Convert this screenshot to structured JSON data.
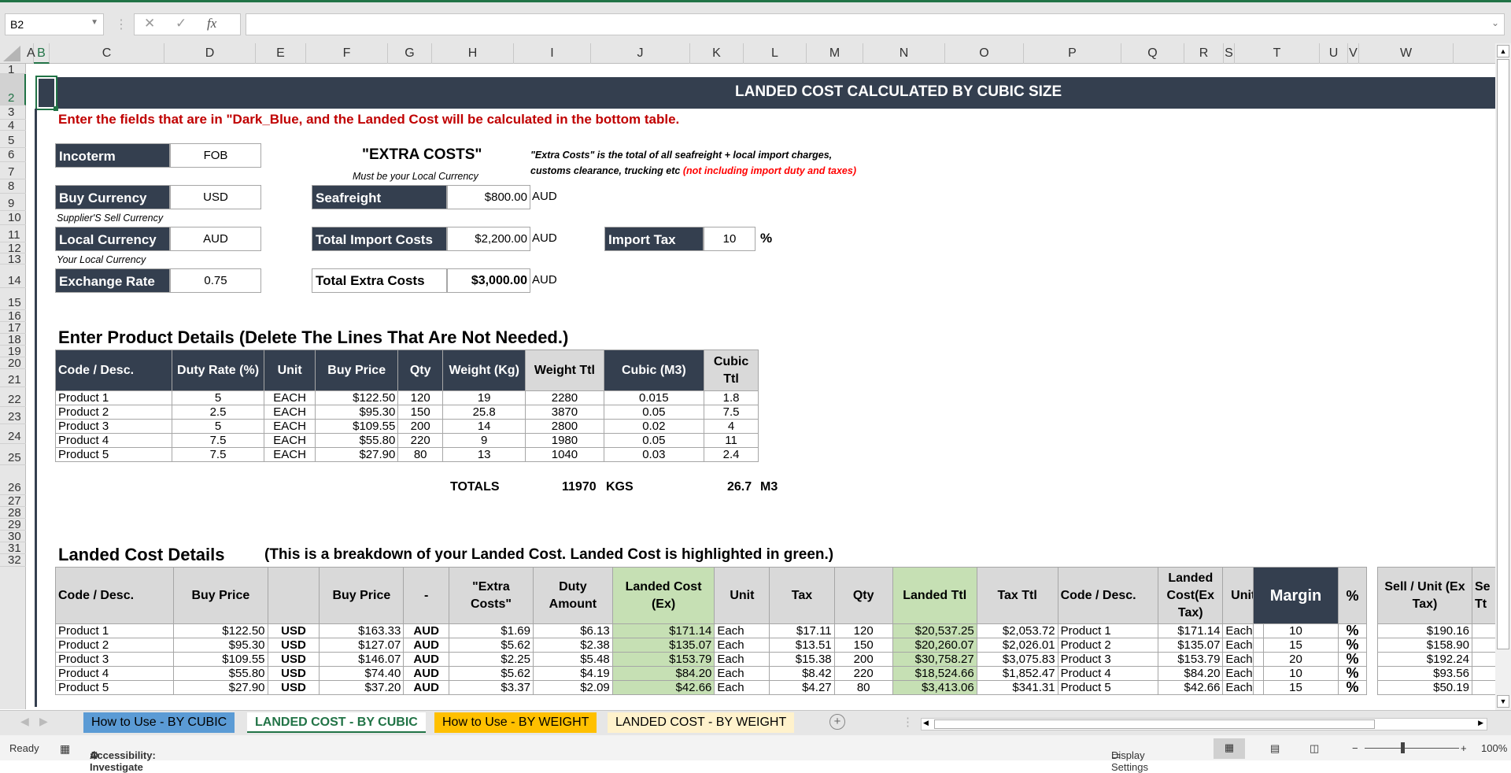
{
  "formula_bar": {
    "name_box": "B2",
    "fx_label": "fx",
    "formula": ""
  },
  "columns": [
    "A",
    "B",
    "C",
    "D",
    "E",
    "F",
    "G",
    "H",
    "I",
    "J",
    "K",
    "L",
    "M",
    "N",
    "O",
    "P",
    "Q",
    "R",
    "S",
    "T",
    "U",
    "V",
    "W"
  ],
  "rows": [
    "1",
    "2",
    "3",
    "4",
    "5",
    "6",
    "7",
    "8",
    "9",
    "10",
    "11",
    "12",
    "13",
    "14",
    "15",
    "16",
    "17",
    "18",
    "19",
    "20",
    "21",
    "22",
    "23",
    "24",
    "25",
    "26",
    "27",
    "28",
    "29",
    "30",
    "31",
    "32"
  ],
  "title": "LANDED COST CALCULATED BY CUBIC SIZE",
  "instruction": "Enter the fields that are in \"Dark_Blue, and the Landed Cost will be calculated in the bottom table.",
  "inputs": {
    "incoterm": {
      "label": "Incoterm",
      "value": "FOB"
    },
    "buy_currency": {
      "label": "Buy Currency",
      "value": "USD",
      "note": "Supplier'S Sell Currency"
    },
    "local_currency": {
      "label": "Local Currency",
      "value": "AUD",
      "note": "Your Local Currency"
    },
    "exchange_rate": {
      "label": "Exchange Rate",
      "value": "0.75"
    }
  },
  "extra_costs": {
    "heading": "\"EXTRA COSTS\"",
    "subheading": "Must be your Local Currency",
    "note_line1": "\"Extra Costs\" is the total of all seafreight + local import charges,",
    "note_line2": "customs clearance, trucking etc",
    "note_red": "(not including import duty and taxes)",
    "seafreight": {
      "label": "Seafreight",
      "value": "$800.00",
      "unit": "AUD"
    },
    "total_import": {
      "label": "Total Import Costs",
      "value": "$2,200.00",
      "unit": "AUD"
    },
    "total_extra": {
      "label": "Total Extra Costs",
      "value": "$3,000.00",
      "unit": "AUD"
    },
    "import_tax": {
      "label": "Import Tax",
      "value": "10",
      "unit": "%"
    }
  },
  "products": {
    "heading": "Enter Product Details (Delete The Lines That Are Not Needed.)",
    "headers": [
      "Code / Desc.",
      "Duty Rate (%)",
      "Unit",
      "Buy Price",
      "Qty",
      "Weight (Kg)",
      "Weight Ttl",
      "Cubic (M3)",
      "Cubic Ttl"
    ],
    "rows": [
      [
        "Product 1",
        "5",
        "EACH",
        "$122.50",
        "120",
        "19",
        "2280",
        "0.015",
        "1.8"
      ],
      [
        "Product 2",
        "2.5",
        "EACH",
        "$95.30",
        "150",
        "25.8",
        "3870",
        "0.05",
        "7.5"
      ],
      [
        "Product 3",
        "5",
        "EACH",
        "$109.55",
        "200",
        "14",
        "2800",
        "0.02",
        "4"
      ],
      [
        "Product 4",
        "7.5",
        "EACH",
        "$55.80",
        "220",
        "9",
        "1980",
        "0.05",
        "11"
      ],
      [
        "Product 5",
        "7.5",
        "EACH",
        "$27.90",
        "80",
        "13",
        "1040",
        "0.03",
        "2.4"
      ]
    ],
    "totals_label": "TOTALS",
    "weight_total": "11970",
    "weight_unit": "KGS",
    "cubic_total": "26.7",
    "cubic_unit": "M3"
  },
  "landed": {
    "heading": "Landed Cost Details",
    "subheading": "(This is a breakdown of your Landed Cost.  Landed Cost is highlighted in green.)",
    "headers": [
      "Code / Desc.",
      "Buy Price",
      "",
      "Buy Price",
      "-",
      "\"Extra Costs\"",
      "Duty Amount",
      "Landed Cost (Ex)",
      "Unit",
      "Tax",
      "Qty",
      "Landed Ttl",
      "Tax Ttl",
      "Code / Desc.",
      "Landed Cost(Ex Tax)",
      "Unit"
    ],
    "rows": [
      [
        "Product 1",
        "$122.50",
        "USD",
        "$163.33",
        "AUD",
        "$1.69",
        "$6.13",
        "$171.14",
        "Each",
        "$17.11",
        "120",
        "$20,537.25",
        "$2,053.72",
        "Product 1",
        "$171.14",
        "Each"
      ],
      [
        "Product 2",
        "$95.30",
        "USD",
        "$127.07",
        "AUD",
        "$5.62",
        "$2.38",
        "$135.07",
        "Each",
        "$13.51",
        "150",
        "$20,260.07",
        "$2,026.01",
        "Product 2",
        "$135.07",
        "Each"
      ],
      [
        "Product 3",
        "$109.55",
        "USD",
        "$146.07",
        "AUD",
        "$2.25",
        "$5.48",
        "$153.79",
        "Each",
        "$15.38",
        "200",
        "$30,758.27",
        "$3,075.83",
        "Product 3",
        "$153.79",
        "Each"
      ],
      [
        "Product 4",
        "$55.80",
        "USD",
        "$74.40",
        "AUD",
        "$5.62",
        "$4.19",
        "$84.20",
        "Each",
        "$8.42",
        "220",
        "$18,524.66",
        "$1,852.47",
        "Product 4",
        "$84.20",
        "Each"
      ],
      [
        "Product 5",
        "$27.90",
        "USD",
        "$37.20",
        "AUD",
        "$3.37",
        "$2.09",
        "$42.66",
        "Each",
        "$4.27",
        "80",
        "$3,413.06",
        "$341.31",
        "Product 5",
        "$42.66",
        "Each"
      ]
    ],
    "margin": {
      "header": "Margin",
      "pct_header": "%",
      "values": [
        "10",
        "15",
        "20",
        "10",
        "15"
      ],
      "pct": "%"
    },
    "sell": {
      "header": "Sell / Unit (Ex Tax)",
      "header2": "Se Tt",
      "values": [
        "$190.16",
        "$158.90",
        "$192.24",
        "$93.56",
        "$50.19"
      ]
    }
  },
  "sheet_tabs": [
    {
      "label": "How to Use - BY CUBIC",
      "color": "#5b9bd5",
      "active": false
    },
    {
      "label": "LANDED COST - BY CUBIC",
      "color": "#ffffff",
      "active": true
    },
    {
      "label": "How to Use - BY WEIGHT",
      "color": "#ffc000",
      "active": false
    },
    {
      "label": "LANDED COST - BY WEIGHT",
      "color": "#fff2cc",
      "active": false
    }
  ],
  "status_bar": {
    "ready": "Ready",
    "accessibility": "Accessibility: Investigate",
    "display_settings": "Display Settings",
    "zoom": "100%"
  },
  "colors": {
    "navy": "#343f4f",
    "green_highlight": "#c6e0b4",
    "header_gray": "#d9d9d9",
    "excel_green": "#217346",
    "red_text": "#c00000"
  }
}
